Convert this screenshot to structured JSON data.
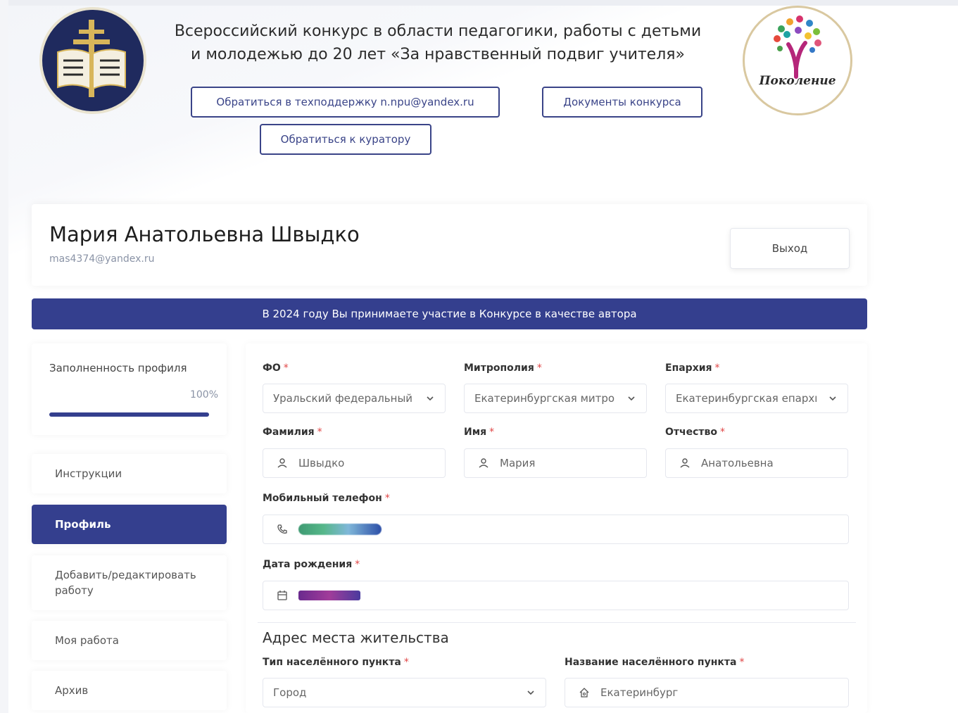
{
  "header": {
    "title_line1": "Всероссийский конкурс в области педагогики, работы с детьми",
    "title_line2": "и молодежью до 20 лет «За нравственный подвиг учителя»",
    "support_button": "Обратиться в техподдержку n.npu@yandex.ru",
    "docs_button": "Документы конкурса",
    "curator_button": "Обратиться к куратору",
    "right_logo_text": "Поколение"
  },
  "profile": {
    "name": "Мария Анатольевна Швыдко",
    "email": "mas4374@yandex.ru",
    "exit_button": "Выход"
  },
  "banner": {
    "text": "В 2024 году Вы принимаете участие в Конкурсе в качестве автора"
  },
  "sidebar": {
    "progress_label": "Заполненность профиля",
    "progress_value": "100%",
    "progress_fraction": 1.0,
    "items": [
      {
        "label": "Инструкции",
        "active": false
      },
      {
        "label": "Профиль",
        "active": true
      },
      {
        "label": "Добавить/редактировать работу",
        "active": false
      },
      {
        "label": "Моя работа",
        "active": false
      },
      {
        "label": "Архив",
        "active": false
      }
    ]
  },
  "form": {
    "fo": {
      "label": "ФО",
      "value": "Уральский федеральный"
    },
    "metropolia": {
      "label": "Митрополия",
      "value": "Екатеринбургская митрополия"
    },
    "eparchy": {
      "label": "Епархия",
      "value": "Екатеринбургская епархия"
    },
    "last_name": {
      "label": "Фамилия",
      "value": "Швыдко"
    },
    "first_name": {
      "label": "Имя",
      "value": "Мария"
    },
    "patronymic": {
      "label": "Отчество",
      "value": "Анатольевна"
    },
    "phone": {
      "label": "Мобильный телефон"
    },
    "birth_date": {
      "label": "Дата рождения"
    },
    "address_title": "Адрес места жительства",
    "settlement_type": {
      "label": "Тип населённого пункта",
      "value": "Город"
    },
    "settlement_name": {
      "label": "Название населённого пункта",
      "value": "Екатеринбург"
    },
    "required_mark": "*"
  }
}
